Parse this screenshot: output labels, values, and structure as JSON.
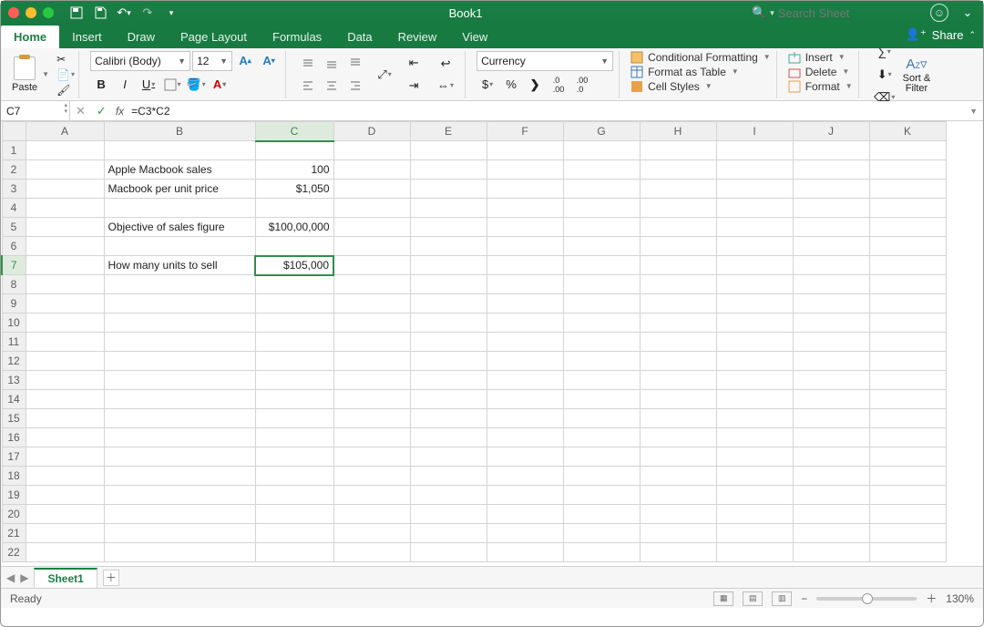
{
  "title": "Book1",
  "search_placeholder": "Search Sheet",
  "tabs": [
    "Home",
    "Insert",
    "Draw",
    "Page Layout",
    "Formulas",
    "Data",
    "Review",
    "View"
  ],
  "active_tab": "Home",
  "share_label": "Share",
  "ribbon": {
    "paste": "Paste",
    "font_name": "Calibri (Body)",
    "font_size": "12",
    "number_format": "Currency",
    "cond_fmt": "Conditional Formatting",
    "fmt_table": "Format as Table",
    "cell_styles": "Cell Styles",
    "insert": "Insert",
    "delete": "Delete",
    "format": "Format",
    "sort_filter": "Sort &\nFilter"
  },
  "name_box": "C7",
  "formula": "=C3*C2",
  "columns": [
    "A",
    "B",
    "C",
    "D",
    "E",
    "F",
    "G",
    "H",
    "I",
    "J",
    "K"
  ],
  "rows": 22,
  "selected": {
    "row": 7,
    "col": "C"
  },
  "cells": {
    "B2": "Apple Macbook sales",
    "C2": "100",
    "B3": "Macbook per unit price",
    "C3": "$1,050",
    "B5": "Objective of sales figure",
    "C5": "$100,00,000",
    "B7": "How many units to sell",
    "C7": "$105,000"
  },
  "col_widths": {
    "_row": 26,
    "A": 86,
    "B": 166,
    "C": 86,
    "D": 84,
    "E": 84,
    "F": 84,
    "G": 84,
    "H": 84,
    "I": 84,
    "J": 84,
    "K": 84
  },
  "sheet_tab": "Sheet1",
  "status": "Ready",
  "zoom": "130%"
}
